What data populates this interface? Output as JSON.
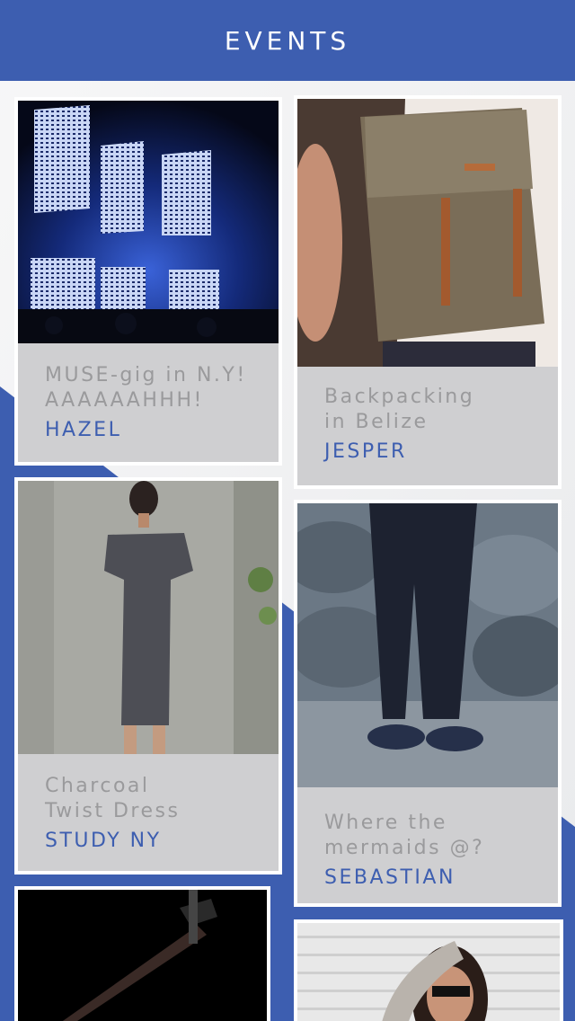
{
  "header": {
    "title": "EVENTS"
  },
  "colors": {
    "brand": "#3d5eb0",
    "card": "#cfcfd1",
    "caption_text": "#9a9a9c"
  },
  "cards": [
    {
      "title": "MUSE-gig in N.Y!\nAAAAAAHHH!",
      "author": "HAZEL",
      "image": "concert-stage-image"
    },
    {
      "title": "Backpacking\nin Belize",
      "author": "JESPER",
      "image": "backpack-image"
    },
    {
      "title": "Charcoal\nTwist Dress",
      "author": "STUDY NY",
      "image": "gray-dress-image"
    },
    {
      "title": "Where the\nmermaids @?",
      "author": "SEBASTIAN",
      "image": "rocks-shoes-image"
    },
    {
      "title": "",
      "author": "",
      "image": "bicycle-image"
    },
    {
      "title": "",
      "author": "",
      "image": "woman-sunglasses-image"
    }
  ]
}
